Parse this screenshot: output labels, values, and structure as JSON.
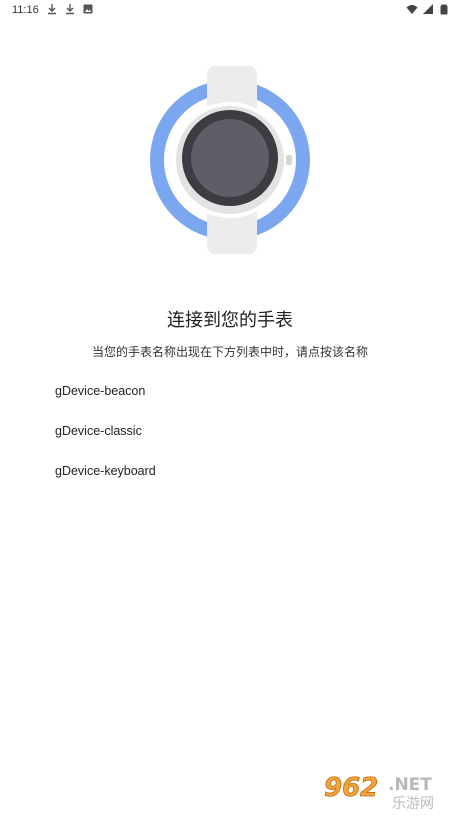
{
  "status_bar": {
    "time": "11:16",
    "left_icons": [
      "download-icon",
      "download-icon",
      "photo-icon"
    ],
    "right_icons": [
      "wifi-icon",
      "signal-icon",
      "battery-icon"
    ]
  },
  "illustration": {
    "icon": "smartwatch-icon",
    "ring_color": "#7ba7f1",
    "band_color": "#ededed",
    "face_color": "#5f5d66"
  },
  "header": {
    "title": "连接到您的手表",
    "subtitle": "当您的手表名称出现在下方列表中时，请点按该名称"
  },
  "devices": [
    "gDevice-beacon",
    "gDevice-classic",
    "gDevice-keyboard"
  ],
  "watermark": {
    "brand_number": "962",
    "brand_suffix": ".NET",
    "brand_cn": "乐游网"
  }
}
